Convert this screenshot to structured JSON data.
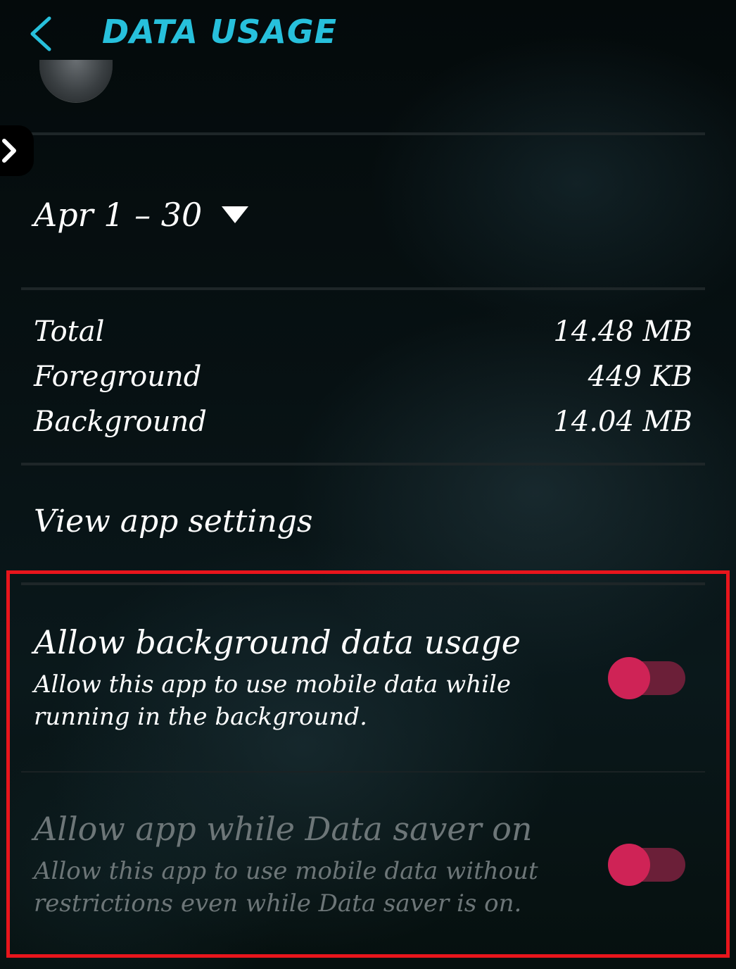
{
  "header": {
    "title": "DATA USAGE",
    "back_icon": "chevron-left-icon",
    "accent_color": "#27c0dc"
  },
  "side_handle": {
    "icon": "chevron-right-icon"
  },
  "period": {
    "label": "Apr 1 – 30",
    "icon": "caret-down-icon"
  },
  "usage": {
    "rows": [
      {
        "label": "Total",
        "value": "14.48 MB"
      },
      {
        "label": "Foreground",
        "value": "449 KB"
      },
      {
        "label": "Background",
        "value": "14.04 MB"
      }
    ]
  },
  "view_app_settings": "View app settings",
  "settings": [
    {
      "title": "Allow background data usage",
      "description": "Allow this app to use mobile data while running in the background.",
      "enabled": true,
      "toggle_on": true
    },
    {
      "title": "Allow app while Data saver on",
      "description": "Allow this app to use mobile data without restrictions even while Data saver is on.",
      "enabled": false,
      "toggle_on": true
    }
  ],
  "colors": {
    "toggle_thumb": "#cf2356",
    "toggle_track": "#6b1f38",
    "highlight_border": "#e8151c"
  }
}
